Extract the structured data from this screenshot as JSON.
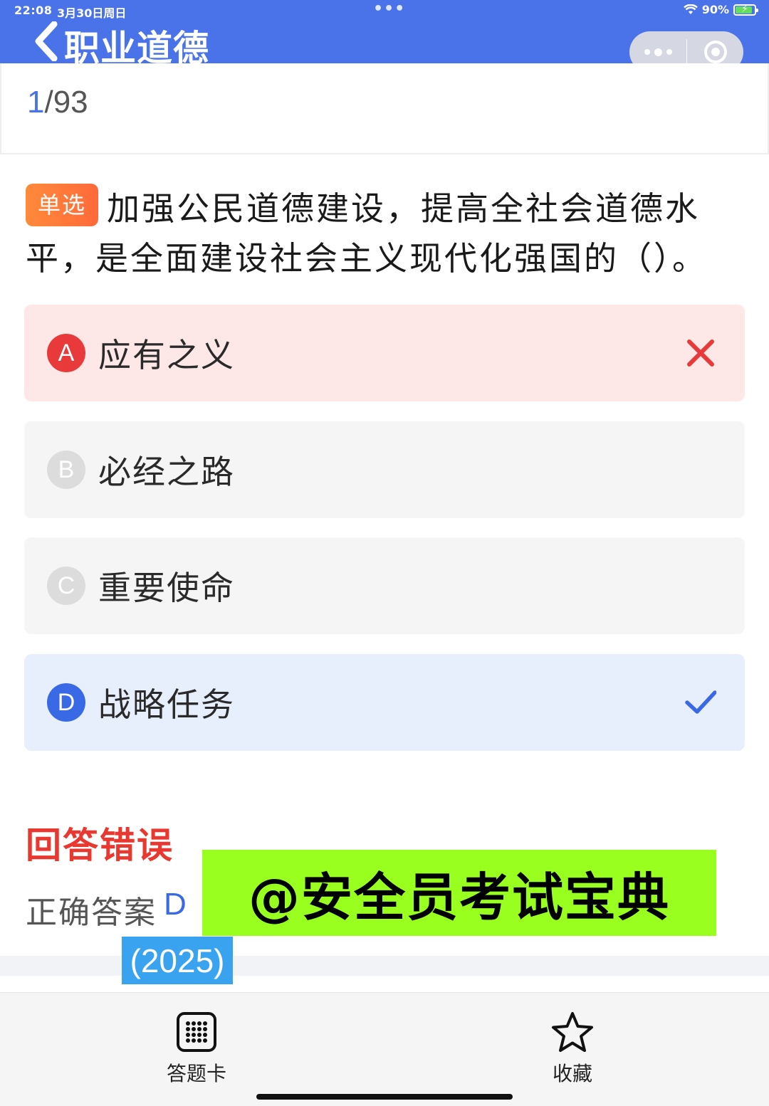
{
  "status_bar": {
    "time": "22:08",
    "date": "3月30日周日",
    "dots": "•••",
    "battery": "90%"
  },
  "nav": {
    "title": "职业道德"
  },
  "progress": {
    "current": "1",
    "total": "/93"
  },
  "question": {
    "type_tag": "单选",
    "text": "加强公民道德建设，提高全社会道德水平，是全面建设社会主义现代化强国的（）。"
  },
  "options": [
    {
      "letter": "A",
      "text": "应有之义",
      "state": "wrong"
    },
    {
      "letter": "B",
      "text": "必经之路",
      "state": "normal"
    },
    {
      "letter": "C",
      "text": "重要使命",
      "state": "normal"
    },
    {
      "letter": "D",
      "text": "战略任务",
      "state": "correct"
    }
  ],
  "result": {
    "title": "回答错误",
    "answer_label": "正确答案",
    "answer_value": "D"
  },
  "overlay": {
    "banner_text": "@安全员考试宝典",
    "year": "(2025)"
  },
  "bottom_bar": {
    "card_label": "答题卡",
    "favorite_label": "收藏"
  },
  "colors": {
    "primary": "#4a73ea",
    "wrong": "#e83a3a",
    "correct": "#3a69e6",
    "tag": "#ff7a3a",
    "banner": "#99ff1e"
  }
}
